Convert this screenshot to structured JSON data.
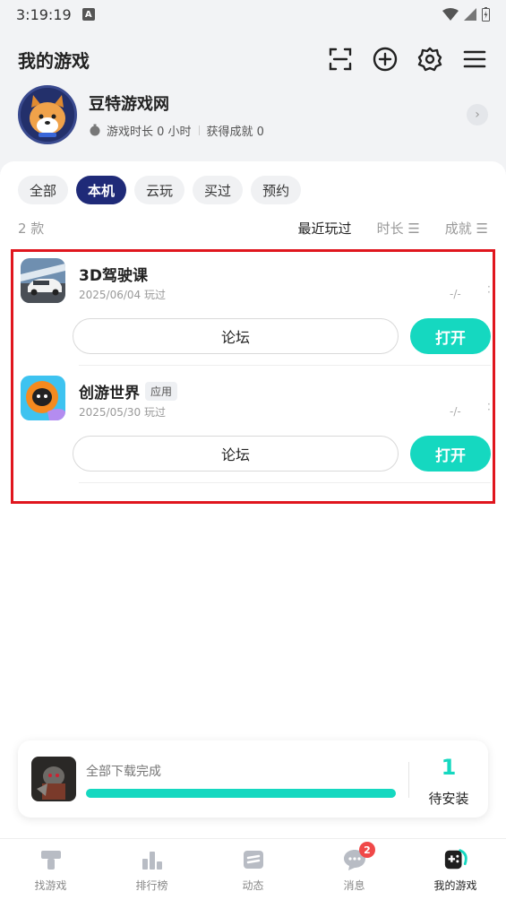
{
  "status_bar": {
    "time": "3:19:19",
    "notification_letter": "A"
  },
  "header": {
    "title": "我的游戏"
  },
  "profile": {
    "name": "豆特游戏网",
    "play_time": "游戏时长 0 小时",
    "achievements": "获得成就 0"
  },
  "filters": {
    "chips": [
      "全部",
      "本机",
      "云玩",
      "买过",
      "预约"
    ],
    "active": "本机"
  },
  "sort": {
    "count": "2 款",
    "options": [
      "最近玩过",
      "时长 ☰",
      "成就 ☰"
    ],
    "active": "最近玩过"
  },
  "games": [
    {
      "name": "3D驾驶课",
      "tag": "",
      "date": "2025/06/04 玩过",
      "stat": "-/-",
      "forum_label": "论坛",
      "open_label": "打开"
    },
    {
      "name": "创游世界",
      "tag": "应用",
      "date": "2025/05/30 玩过",
      "stat": "-/-",
      "forum_label": "论坛",
      "open_label": "打开"
    }
  ],
  "download": {
    "status": "全部下载完成",
    "progress": 1.0,
    "pending_count": "1",
    "pending_label": "待安装"
  },
  "bottom_nav": {
    "items": [
      {
        "label": "找游戏",
        "icon": "hammer-icon"
      },
      {
        "label": "排行榜",
        "icon": "ranking-icon"
      },
      {
        "label": "动态",
        "icon": "feed-icon"
      },
      {
        "label": "消息",
        "icon": "message-icon",
        "badge": "2"
      },
      {
        "label": "我的游戏",
        "icon": "gamepad-icon"
      }
    ],
    "active": "我的游戏"
  },
  "colors": {
    "accent": "#15d8c0",
    "chip_active": "#1f2a78",
    "highlight_border": "#e0161e",
    "badge": "#f04848"
  }
}
